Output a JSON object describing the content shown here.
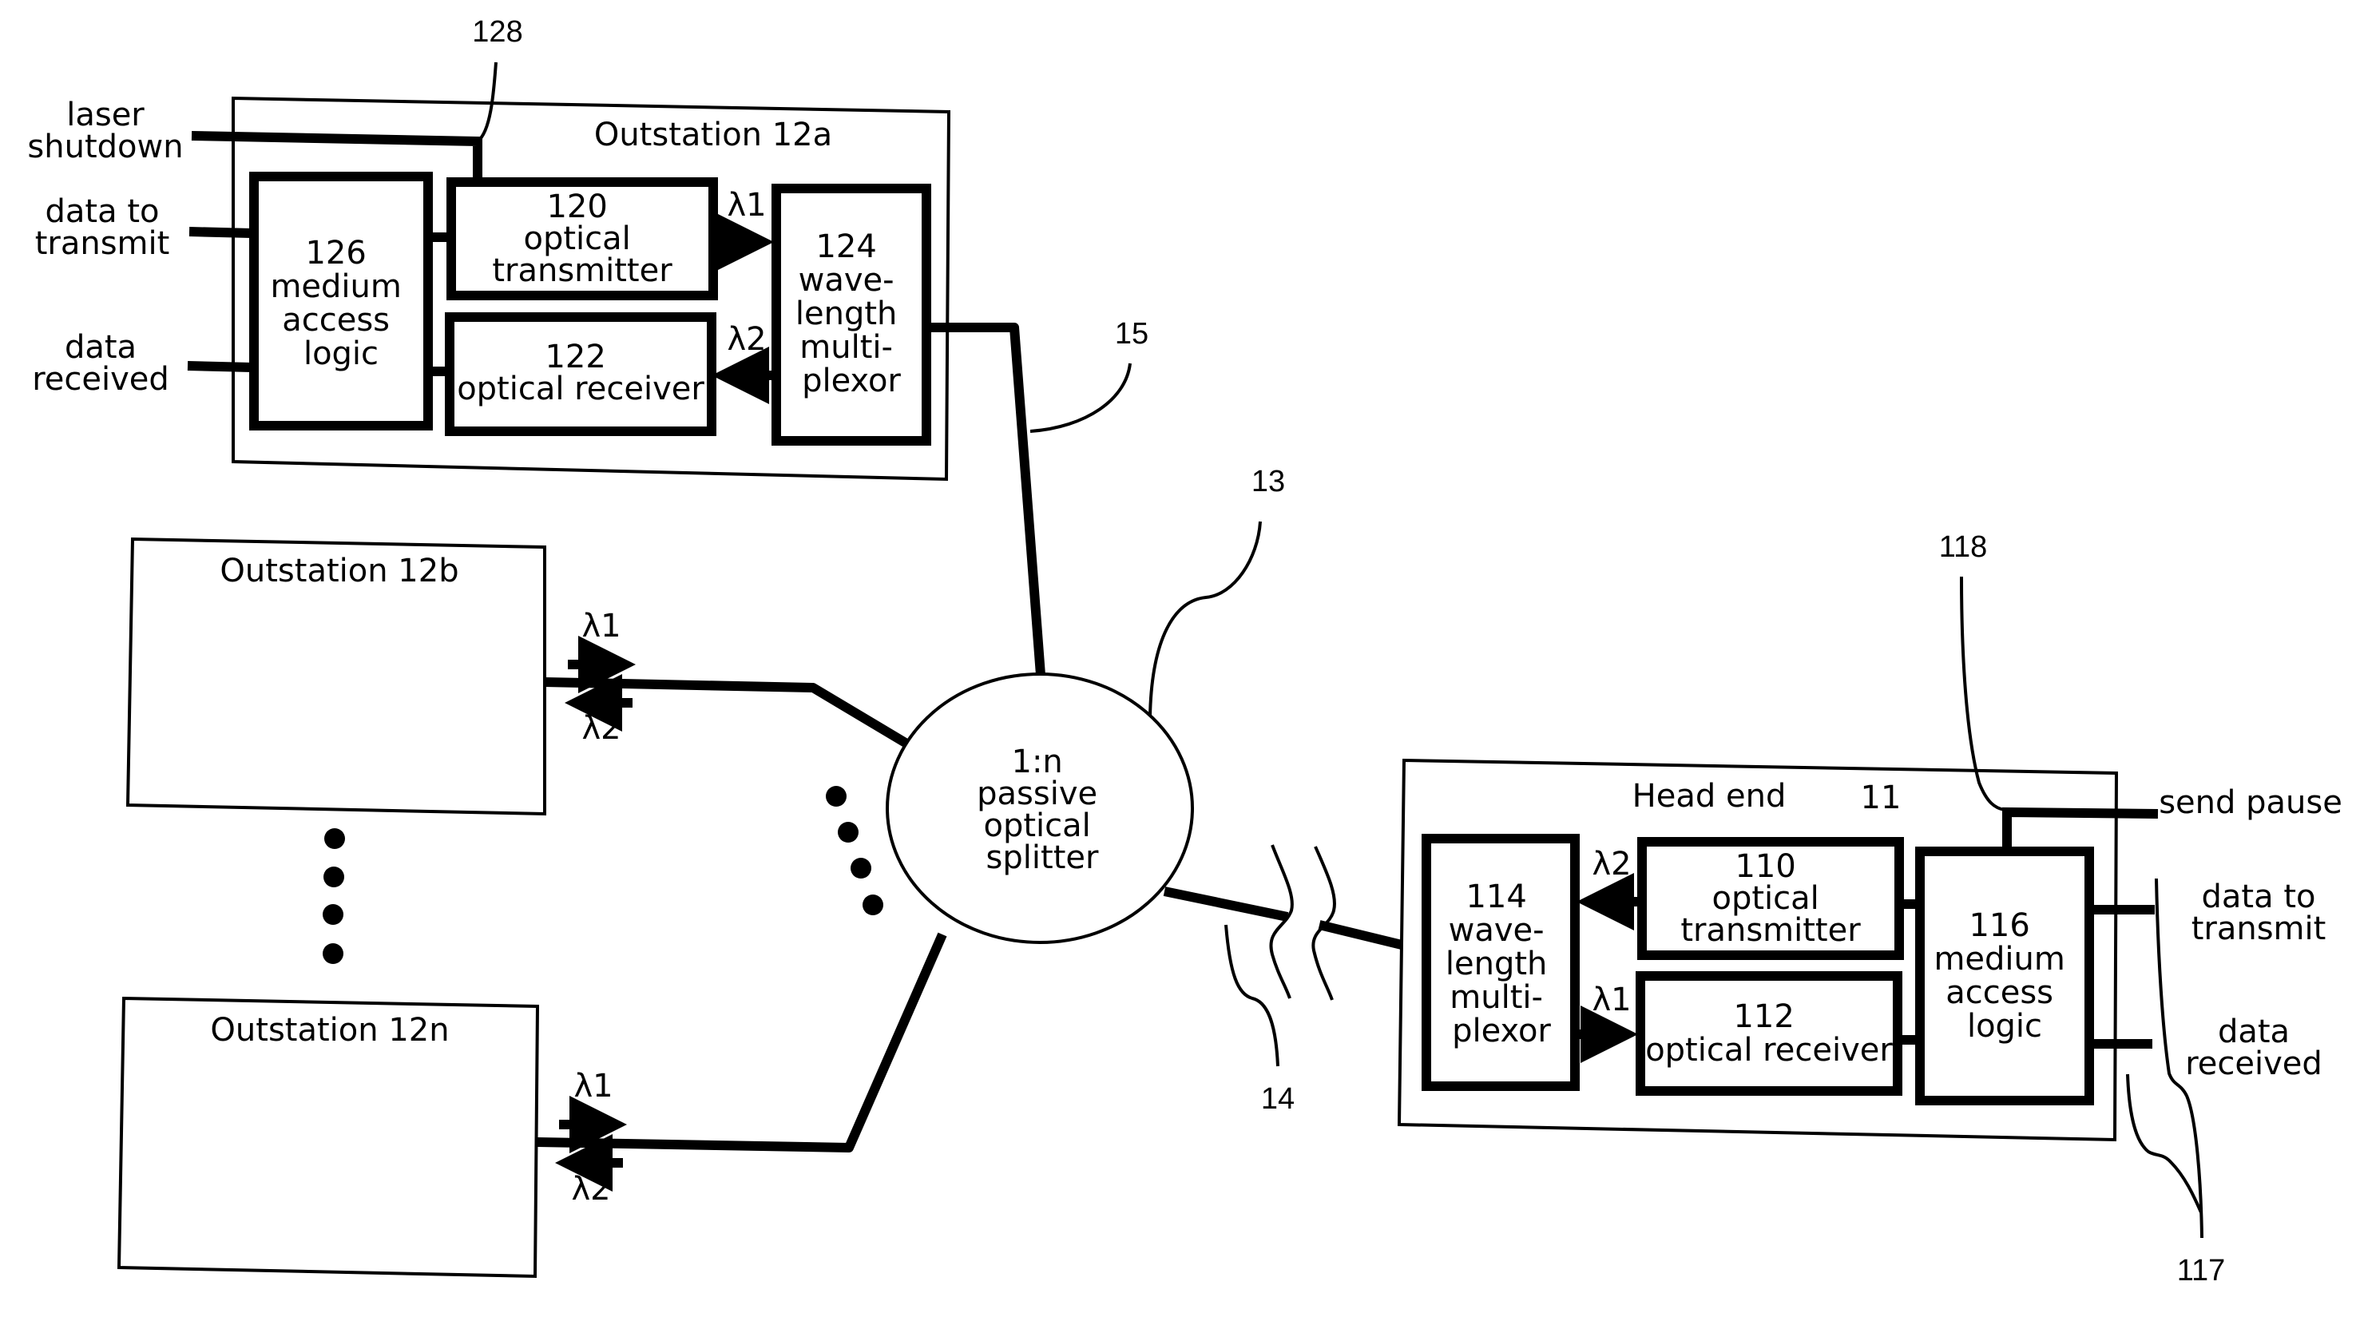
{
  "figure": {
    "outstation_a": {
      "title": "Outstation 12a",
      "ref_128": "128",
      "ref_15": "15",
      "inputs": {
        "laser_shutdown": [
          "laser",
          "shutdown"
        ],
        "data_to_transmit": [
          "data to",
          "transmit"
        ],
        "data_received": [
          "data",
          "received"
        ]
      },
      "mac": [
        "126",
        "medium",
        "access",
        "logic"
      ],
      "transmitter": [
        "120",
        "optical",
        "transmitter"
      ],
      "receiver": [
        "122",
        "optical receiver"
      ],
      "mux": [
        "124",
        "wave-",
        "length",
        "multi-",
        "plexor"
      ],
      "lambda_tx": "λ1",
      "lambda_rx": "λ2"
    },
    "outstation_b": {
      "title": "Outstation 12b",
      "lambda_up": "λ1",
      "lambda_down": "λ2"
    },
    "outstation_n": {
      "title": "Outstation 12n",
      "lambda_up": "λ1",
      "lambda_down": "λ2"
    },
    "splitter": {
      "lines": [
        "1:n",
        "passive",
        "optical",
        "splitter"
      ],
      "ref": "13"
    },
    "trunk_ref": "14",
    "head_end": {
      "title": "Head end",
      "ref": "11",
      "ref_118": "118",
      "ref_117": "117",
      "outputs": {
        "send_pause": "send pause",
        "data_to_transmit": [
          "data to",
          "transmit"
        ],
        "data_received": [
          "data",
          "received"
        ]
      },
      "mux": [
        "114",
        "wave-",
        "length",
        "multi-",
        "plexor"
      ],
      "transmitter": [
        "110",
        "optical",
        "transmitter"
      ],
      "receiver": [
        "112",
        "optical receiver"
      ],
      "mac": [
        "116",
        "medium",
        "access",
        "logic"
      ],
      "lambda_tx": "λ2",
      "lambda_rx": "λ1"
    }
  }
}
